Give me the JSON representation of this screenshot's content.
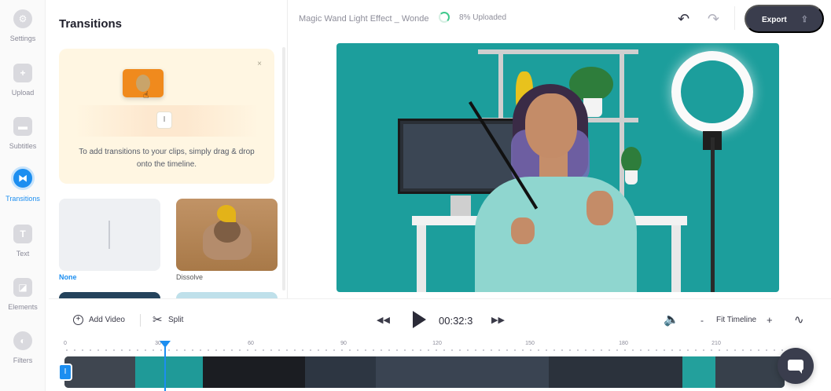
{
  "sidebar": {
    "items": [
      {
        "label": "Settings",
        "icon": "gear-icon"
      },
      {
        "label": "Upload",
        "icon": "plus-icon"
      },
      {
        "label": "Subtitles",
        "icon": "subtitles-icon"
      },
      {
        "label": "Transitions",
        "icon": "transitions-icon",
        "active": true
      },
      {
        "label": "Text",
        "icon": "text-icon"
      },
      {
        "label": "Elements",
        "icon": "elements-icon"
      },
      {
        "label": "Filters",
        "icon": "filters-icon"
      }
    ]
  },
  "panel": {
    "title": "Transitions",
    "hint": {
      "text": "To add transitions to your clips, simply drag & drop onto the timeline.",
      "close": "×",
      "marker": "I"
    },
    "cards": [
      {
        "label": "None",
        "selected": true
      },
      {
        "label": "Dissolve"
      }
    ]
  },
  "header": {
    "project_name": "Magic Wand Light Effect _ Wonde",
    "upload_status": "8% Uploaded",
    "undo": "↶",
    "redo": "↷",
    "export_label": "Export",
    "export_icon": "⇪"
  },
  "controls": {
    "add_video": "Add Video",
    "add_video_icon": "+",
    "split": "Split",
    "split_icon": "✂",
    "rewind": "◀◀",
    "forward": "▶▶",
    "timecode": "00:32:3",
    "volume": "🔈",
    "zoom_minus": "-",
    "zoom_label": "Fit Timeline",
    "zoom_plus": "+",
    "wave": "∿"
  },
  "timeline": {
    "ticks": [
      "0",
      "30",
      "60",
      "90",
      "120",
      "150",
      "180",
      "210"
    ],
    "track_handle": "I",
    "playhead_seconds": 32.3
  },
  "colors": {
    "accent": "#1c8ef0",
    "export_bg": "#3a3d4d",
    "preview_bg": "#1c9e9c",
    "upload_green": "#3fc98c"
  }
}
